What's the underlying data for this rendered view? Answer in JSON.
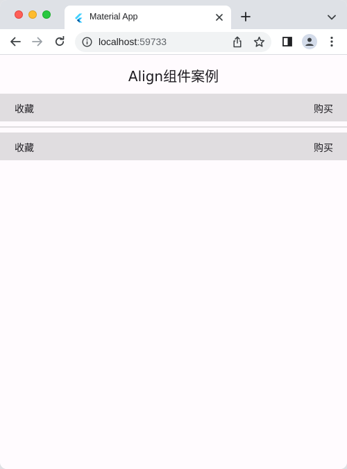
{
  "browser": {
    "tab": {
      "title": "Material App",
      "favicon": "flutter-icon"
    },
    "address_bar": {
      "host": "localhost",
      "port": ":59733"
    },
    "icons": {
      "back": "back-arrow-icon",
      "forward": "forward-arrow-icon",
      "reload": "reload-icon",
      "info": "info-icon",
      "share": "share-icon",
      "bookmark": "star-icon",
      "side_panel": "side-panel-icon",
      "profile": "profile-icon",
      "menu": "kebab-menu-icon",
      "new_tab": "plus-icon",
      "tab_search": "chevron-down-icon",
      "close_tab": "close-icon"
    }
  },
  "app": {
    "title": "Align组件案例",
    "rows": [
      {
        "left": "收藏",
        "right": "购买"
      },
      {
        "left": "收藏",
        "right": "购买"
      }
    ]
  },
  "colors": {
    "background": "#fffbfe",
    "row_background": "#e0dde0",
    "text": "#1d1b20"
  }
}
